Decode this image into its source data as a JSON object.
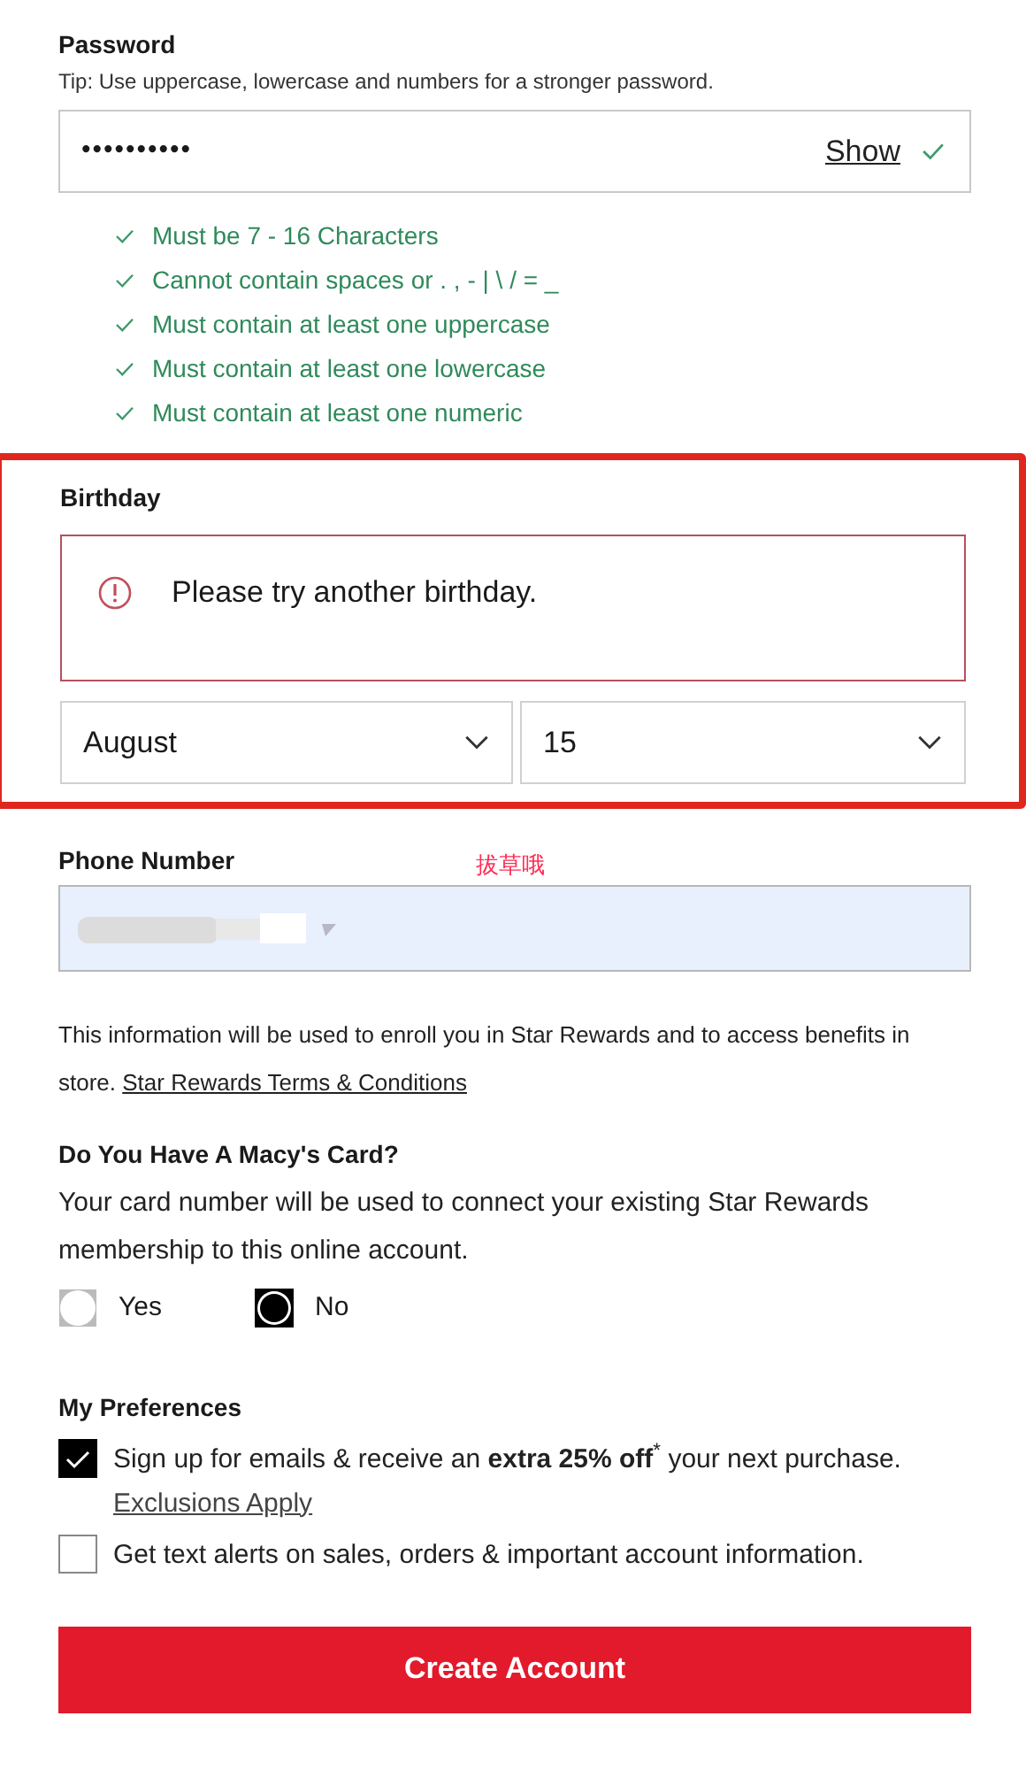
{
  "password": {
    "label": "Password",
    "tip": "Tip: Use uppercase, lowercase and numbers for a stronger password.",
    "value": "••••••••••",
    "show_label": "Show",
    "valid": true,
    "rules": [
      {
        "text": "Must be 7 - 16 Characters",
        "met": true
      },
      {
        "text": "Cannot contain spaces or . , - | \\ / = _",
        "met": true
      },
      {
        "text": "Must contain at least one uppercase",
        "met": true
      },
      {
        "text": "Must contain at least one lowercase",
        "met": true
      },
      {
        "text": "Must contain at least one numeric",
        "met": true
      }
    ]
  },
  "birthday": {
    "label": "Birthday",
    "error": "Please try another birthday.",
    "month": "August",
    "day": "15"
  },
  "annotation": {
    "note": "拔草哦"
  },
  "phone": {
    "label": "Phone Number"
  },
  "info": {
    "text": "This information will be used to enroll you in Star Rewards and to access benefits in store.",
    "link": "Star Rewards Terms & Conditions"
  },
  "macys_card": {
    "heading": "Do You Have A Macy's Card?",
    "description": "Your card number will be used to connect your existing Star Rewards membership to this online account.",
    "options": [
      {
        "label": "Yes",
        "selected": false
      },
      {
        "label": "No",
        "selected": true
      }
    ]
  },
  "preferences": {
    "heading": "My Preferences",
    "options": [
      {
        "text": "Sign up for emails & receive an **extra 25% off**$^{*}$ your next purchase.",
        "link": "Exclusions Apply",
        "checked": true
      },
      {
        "text": "Get text alerts on sales, orders & important account information.",
        "checked": false
      }
    ]
  },
  "submit": "Create Account"
}
